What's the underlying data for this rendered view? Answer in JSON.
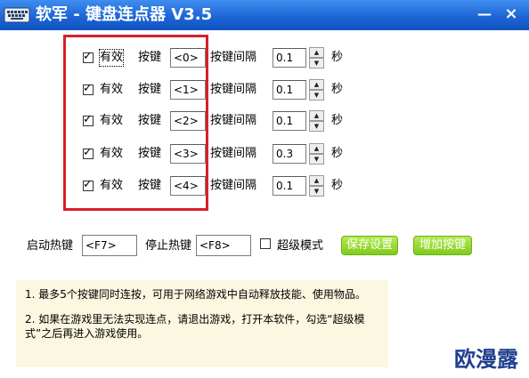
{
  "window": {
    "title": "软军 - 键盘连点器 V3.5",
    "minimize_glyph": "—",
    "close_glyph": "×",
    "app_icon": "keyboard-icon"
  },
  "rows": [
    {
      "enabled": true,
      "enabled_label": "有效",
      "key_label": "按键",
      "key_value": "<0>",
      "interval_label": "按键间隔",
      "interval_value": "0.1",
      "unit": "秒"
    },
    {
      "enabled": true,
      "enabled_label": "有效",
      "key_label": "按键",
      "key_value": "<1>",
      "interval_label": "按键间隔",
      "interval_value": "0.1",
      "unit": "秒"
    },
    {
      "enabled": true,
      "enabled_label": "有效",
      "key_label": "按键",
      "key_value": "<2>",
      "interval_label": "按键间隔",
      "interval_value": "0.1",
      "unit": "秒"
    },
    {
      "enabled": true,
      "enabled_label": "有效",
      "key_label": "按键",
      "key_value": "<3>",
      "interval_label": "按键间隔",
      "interval_value": "0.3",
      "unit": "秒"
    },
    {
      "enabled": true,
      "enabled_label": "有效",
      "key_label": "按键",
      "key_value": "<4>",
      "interval_label": "按键间隔",
      "interval_value": "0.1",
      "unit": "秒"
    }
  ],
  "hotkeys": {
    "start_label": "启动热键",
    "start_value": "<F7>",
    "stop_label": "停止热键",
    "stop_value": "<F8>",
    "super_mode_label": "超级模式",
    "super_mode_checked": false
  },
  "buttons": {
    "save_label": "保存设置",
    "add_key_label": "增加按键"
  },
  "info": {
    "line1": "1. 最多5个按键同时连按，可用于网络游戏中自动释放技能、使用物品。",
    "line2": "2. 如果在游戏里无法实现连点，请退出游戏，打开本软件，勾选“超级模式”之后再进入游戏使用。"
  },
  "watermark": "欧漫露",
  "colors": {
    "titlebar": "#1d66d4",
    "highlight_box": "#d81e2a",
    "green_button": "#8fd125",
    "info_background": "#fbf7e0",
    "watermark": "#1f3f8f"
  }
}
